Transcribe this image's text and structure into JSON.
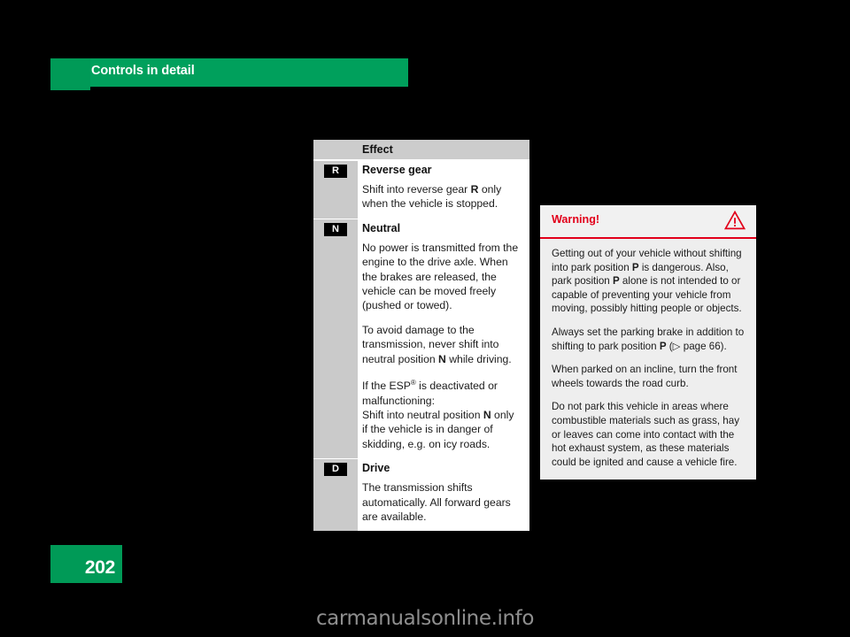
{
  "header": {
    "chapter_title": "Controls in detail",
    "accent_color": "#00a05c",
    "tab_color": "#009a57"
  },
  "table": {
    "column_header": "Effect",
    "rows": [
      {
        "badge": "R",
        "name": "Reverse gear",
        "paragraphs": [
          {
            "pre": "Shift into reverse gear ",
            "bold": "R",
            "post": " only when the vehicle is stopped."
          }
        ]
      },
      {
        "badge": "N",
        "name": "Neutral",
        "paragraphs": [
          {
            "pre": "No power is transmitted from the engine to the drive axle. When the brakes are released, the vehicle can be moved freely (pushed or towed).",
            "bold": "",
            "post": ""
          },
          {
            "pre": "To avoid damage to the transmission, never shift into neutral position ",
            "bold": "N",
            "post": " while driving."
          },
          {
            "pre": "If the ESP",
            "bold": "",
            "post": " is deactivated or malfunctioning:"
          },
          {
            "pre": "Shift into neutral position ",
            "bold": "N",
            "post": " only if the vehicle is in danger of skidding, e.g. on icy roads."
          }
        ]
      },
      {
        "badge": "D",
        "name": "Drive",
        "paragraphs": [
          {
            "pre": "The transmission shifts automatically. All forward gears are available.",
            "bold": "",
            "post": ""
          }
        ]
      }
    ]
  },
  "warning": {
    "title": "Warning!",
    "icon": "warning-triangle-icon",
    "accent_color": "#e2001a",
    "paragraphs": [
      {
        "t1": "Getting out of your vehicle without shifting into park position ",
        "b1": "P",
        "t2": " is dangerous. Also, park position ",
        "b2": "P",
        "t3": " alone is not intended to or capable of preventing your vehicle from moving, possibly hitting people or objects."
      },
      {
        "t1": "Always set the parking brake in addition to shifting to park position ",
        "b1": "P",
        "t2": " (▷ page 66).",
        "b2": "",
        "t3": ""
      },
      {
        "t1": "When parked on an incline, turn the front wheels towards the road curb.",
        "b1": "",
        "t2": "",
        "b2": "",
        "t3": ""
      },
      {
        "t1": "Do not park this vehicle in areas where combustible materials such as grass, hay or leaves can come into contact with the hot exhaust system, as these materials could be ignited and cause a vehicle fire.",
        "b1": "",
        "t2": "",
        "b2": "",
        "t3": ""
      }
    ]
  },
  "footer": {
    "page_number": "202",
    "watermark": "carmanualsonline.info"
  }
}
